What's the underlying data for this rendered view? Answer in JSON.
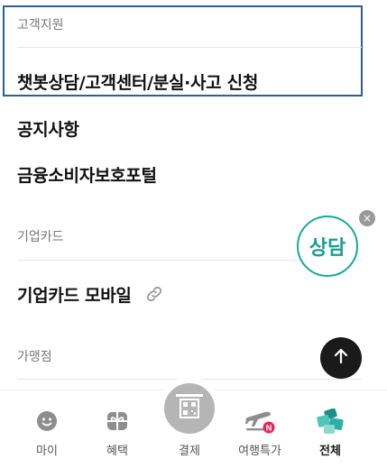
{
  "sections": {
    "support": {
      "title": "고객지원",
      "items": [
        "챗봇상담/고객센터/분실·사고 신청",
        "공지사항",
        "금융소비자보호포털"
      ]
    },
    "corporate": {
      "title": "기업카드",
      "items": [
        "기업카드 모바일"
      ]
    },
    "merchant": {
      "title": "가맹점"
    }
  },
  "floating": {
    "consult_label": "상담",
    "close_symbol": "×"
  },
  "tabbar": {
    "tabs": [
      {
        "label": "마이",
        "icon": "smiley-icon"
      },
      {
        "label": "혜택",
        "icon": "gift-icon"
      },
      {
        "label": "결제",
        "icon": "qr-code-icon"
      },
      {
        "label": "여행특가",
        "icon": "airplane-icon",
        "badge": "N"
      },
      {
        "label": "전체",
        "icon": "all-menu-icon",
        "active": true
      }
    ]
  },
  "colors": {
    "accent": "#1aa79b",
    "focus_border": "#2f5f8f",
    "badge": "#e8255a"
  }
}
